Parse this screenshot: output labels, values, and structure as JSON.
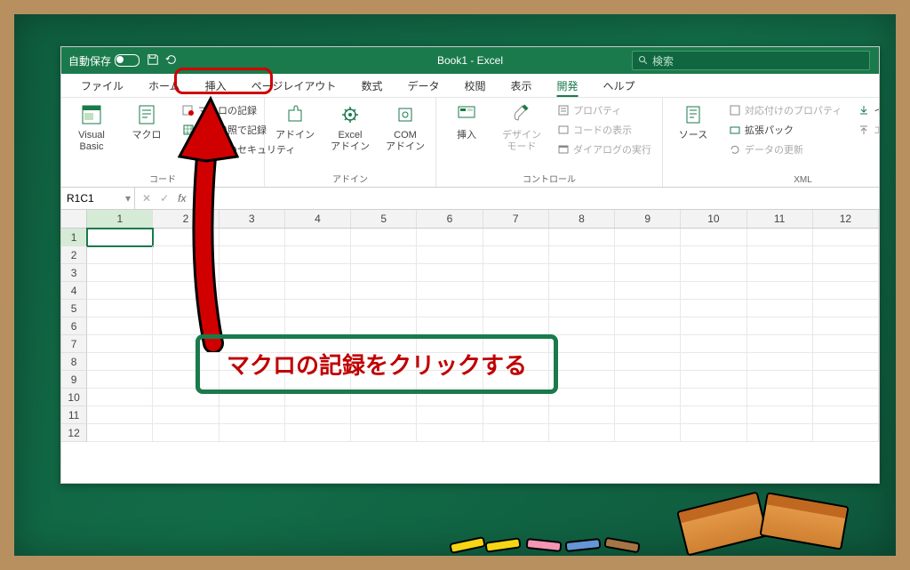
{
  "titlebar": {
    "autosave_label": "自動保存",
    "doc_title": "Book1 - Excel",
    "search_placeholder": "検索"
  },
  "tabs": {
    "file": "ファイル",
    "home": "ホーム",
    "insert": "挿入",
    "pagelayout": "ページレイアウト",
    "formulas": "数式",
    "data": "データ",
    "review": "校閲",
    "view": "表示",
    "developer": "開発",
    "help": "ヘルプ"
  },
  "ribbon": {
    "vb_label": "Visual Basic",
    "macro_label": "マクロ",
    "record_macro": "マクロの記録",
    "relative_ref": "相対参照で記録",
    "macro_security": "マクロのセキュリティ",
    "group_code": "コード",
    "addin_label": "アドイン",
    "excel_addin": "Excel\nアドイン",
    "com_addin": "COM\nアドイン",
    "group_addin": "アドイン",
    "insert_label": "挿入",
    "design_mode": "デザイン\nモード",
    "properties": "プロパティ",
    "view_code": "コードの表示",
    "run_dialog": "ダイアログの実行",
    "group_controls": "コントロール",
    "source_label": "ソース",
    "map_props": "対応付けのプロパティ",
    "expansion_pack": "拡張パック",
    "refresh_data": "データの更新",
    "import_label": "インポート",
    "export_label": "エクスポート",
    "group_xml": "XML"
  },
  "formula_bar": {
    "name_box": "R1C1",
    "fx": "fx"
  },
  "grid": {
    "columns": [
      "1",
      "2",
      "3",
      "4",
      "5",
      "6",
      "7",
      "8",
      "9",
      "10",
      "11",
      "12"
    ],
    "rows": [
      "1",
      "2",
      "3",
      "4",
      "5",
      "6",
      "7",
      "8",
      "9",
      "10",
      "11",
      "12"
    ]
  },
  "annotation": "マクロの記録をクリックする"
}
